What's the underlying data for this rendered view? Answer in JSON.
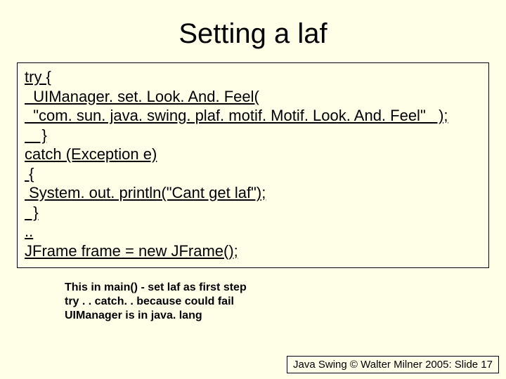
{
  "title": "Setting a laf",
  "code": {
    "l1": "try {",
    "l2": "  UIManager. set. Look. And. Feel(",
    "l3": "  \"com. sun. java. swing. plaf. motif. Motif. Look. And. Feel\"   );",
    "l4": "    }",
    "l5": "catch (Exception e)",
    "l6": " {",
    "l7": " System. out. println(\"Cant get laf\");",
    "l8": "  }",
    "l9": "..",
    "l10": "JFrame frame = new JFrame();"
  },
  "note": {
    "n1": "This in main() - set laf as first step",
    "n2": "try . . catch. . because could fail",
    "n3": "UIManager is in java. lang"
  },
  "footer": "Java Swing © Walter Milner 2005: Slide 17"
}
